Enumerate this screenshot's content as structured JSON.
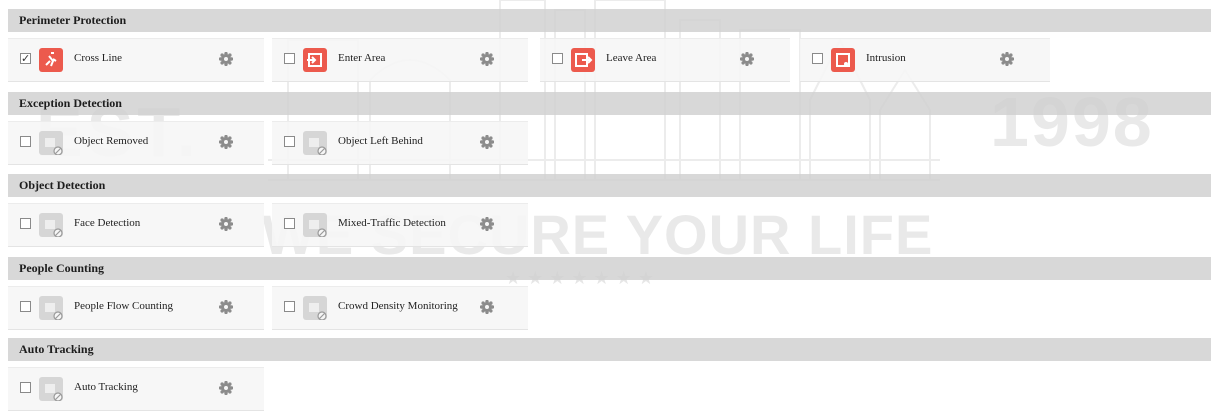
{
  "watermark": {
    "est": "EST.",
    "year": "1998",
    "slogan": "WE SECURE YOUR LIFE",
    "stars": "★★★★★★★"
  },
  "sections": [
    {
      "title": "Perimeter Protection",
      "items": [
        {
          "label": "Cross Line",
          "checked": true,
          "icon": "cross-line-icon",
          "active": true
        },
        {
          "label": "Enter Area",
          "checked": false,
          "icon": "enter-area-icon",
          "active": true
        },
        {
          "label": "Leave Area",
          "checked": false,
          "icon": "leave-area-icon",
          "active": true
        },
        {
          "label": "Intrusion",
          "checked": false,
          "icon": "intrusion-icon",
          "active": true
        }
      ]
    },
    {
      "title": "Exception Detection",
      "items": [
        {
          "label": "Object Removed",
          "checked": false,
          "icon": "object-removed-icon",
          "active": false
        },
        {
          "label": "Object Left Behind",
          "checked": false,
          "icon": "object-left-behind-icon",
          "active": false
        }
      ]
    },
    {
      "title": "Object Detection",
      "items": [
        {
          "label": "Face Detection",
          "checked": false,
          "icon": "face-detection-icon",
          "active": false
        },
        {
          "label": "Mixed-Traffic Detection",
          "checked": false,
          "icon": "mixed-traffic-icon",
          "active": false
        }
      ]
    },
    {
      "title": "People Counting",
      "items": [
        {
          "label": "People Flow Counting",
          "checked": false,
          "icon": "people-flow-icon",
          "active": false
        },
        {
          "label": "Crowd Density Monitoring",
          "checked": false,
          "icon": "crowd-density-icon",
          "active": false
        }
      ]
    },
    {
      "title": "Auto Tracking",
      "items": [
        {
          "label": "Auto Tracking",
          "checked": false,
          "icon": "auto-tracking-icon",
          "active": false
        }
      ]
    }
  ],
  "colors": {
    "active_icon": "#ec5a4d",
    "inactive_icon": "#d6d6d6",
    "gear": "#8c8c8c",
    "section_bg": "#d0d0d0"
  }
}
